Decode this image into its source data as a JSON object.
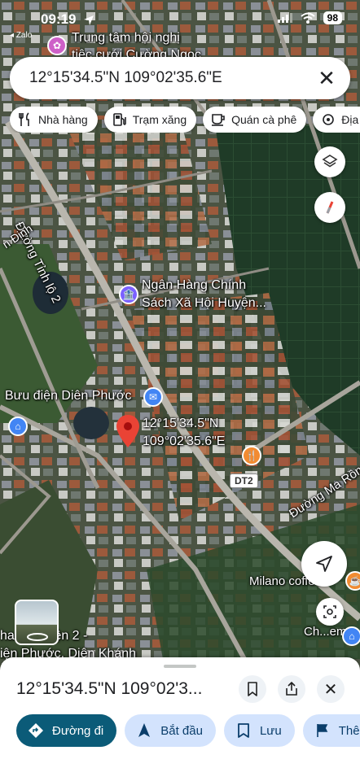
{
  "status_bar": {
    "time": "09:19",
    "notification": "Zalo",
    "battery": "98"
  },
  "search": {
    "query": "12°15'34.5\"N 109°02'35.6\"E"
  },
  "chips": [
    {
      "label": "Nhà hàng",
      "icon": "restaurant-icon"
    },
    {
      "label": "Trạm xăng",
      "icon": "gas-station-icon"
    },
    {
      "label": "Quán cà phê",
      "icon": "coffee-icon"
    },
    {
      "label": "Địa đ",
      "icon": "attraction-icon"
    }
  ],
  "map": {
    "labels": {
      "top_poi_line1": "Trung tâm hội nghị",
      "top_poi_line2": "tiệc cưới Cường Ngọc",
      "road_tinh_lo": "Đường Tỉnh lộ 2",
      "road_an_dinh": "n Định",
      "bank_line1": "Ngân Hàng Chính",
      "bank_line2": "Sách Xã Hội Huyện...",
      "post_office": "Bưu điện Diên Phước",
      "pin_line1": "12°15'34.5\"N",
      "pin_line2": "109°02'35.6\"E",
      "road_badge": "DT2",
      "road_ma": "Đường Ma Rồn",
      "milano": "Milano coffee",
      "ch_em": "Ch...em",
      "bottom_line1": "ha   ân Thiện 2 -",
      "bottom_line2": "iện Phước, Diên Khánh"
    },
    "colors": {
      "pin": "#ea4335",
      "food": "#f28b31",
      "shop": "#4285f4",
      "bank_icon": "#7b61ff"
    }
  },
  "sheet": {
    "title": "12°15'34.5\"N 109°02'3...",
    "actions": [
      {
        "label": "Đường đi",
        "icon": "directions-icon"
      },
      {
        "label": "Bắt đầu",
        "icon": "navigation-arrow-icon"
      },
      {
        "label": "Lưu",
        "icon": "bookmark-icon"
      },
      {
        "label": "Thêm",
        "icon": "flag-icon"
      }
    ]
  }
}
